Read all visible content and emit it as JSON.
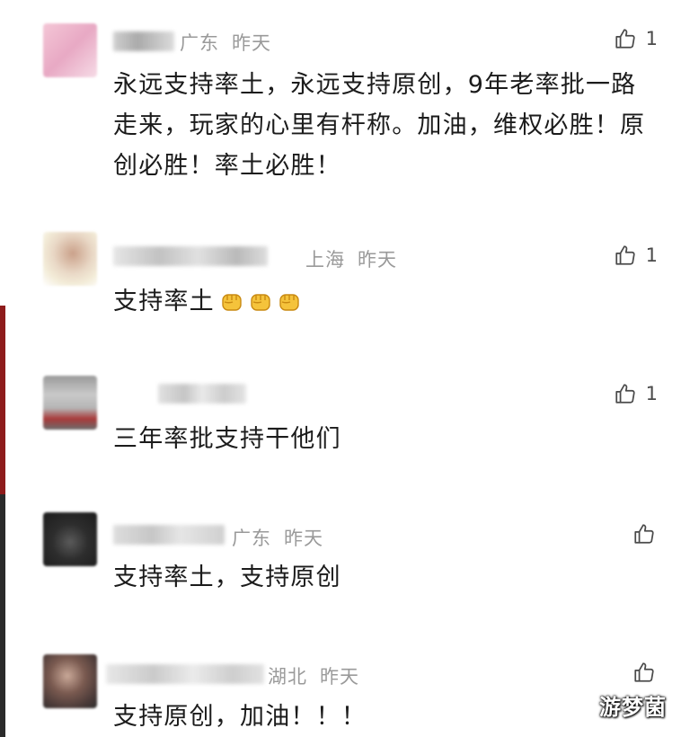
{
  "comments": [
    {
      "location": "广东",
      "time": "昨天",
      "text": "永远支持率土，永远支持原创，9年老率批一路走来，玩家的心里有杆称。加油，维权必胜！原创必胜！率土必胜！",
      "likes": "1"
    },
    {
      "location": "上海",
      "time": "昨天",
      "text": "支持率土",
      "emoji_icon": "raised-fist-icon",
      "emoji_count": 3,
      "likes": "1"
    },
    {
      "location": "",
      "time": "",
      "text": "三年率批支持干他们",
      "likes": "1"
    },
    {
      "location": "广东",
      "time": "昨天",
      "text": "支持率土，支持原创",
      "likes": ""
    },
    {
      "location": "湖北",
      "time": "昨天",
      "text": "支持原创，加油！！！",
      "likes": ""
    }
  ],
  "like_icon": "thumbs-up-icon",
  "watermark": "游梦菌",
  "colors": {
    "meta_text": "#9a9a9a",
    "body_text": "#1b1b1b",
    "edge_strip": "#2a2a2a",
    "edge_accent": "#8e1b1b"
  }
}
